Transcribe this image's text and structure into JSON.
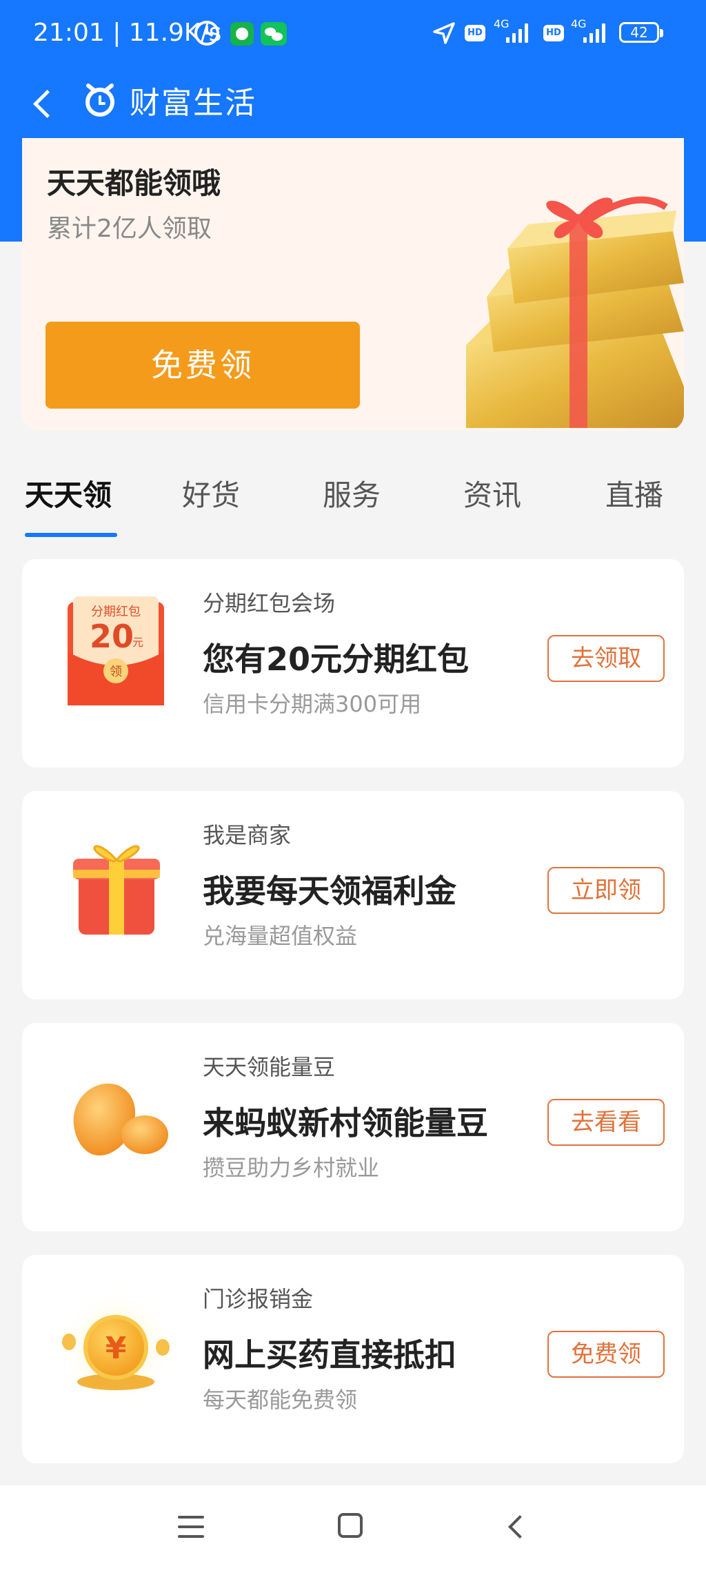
{
  "status_bar": {
    "time_speed": "21:01 | 11.9K/s",
    "network_1": "4G",
    "network_2": "4G",
    "hd_label": "HD",
    "battery": "42",
    "icons": [
      "alarm-icon",
      "app-notification-icon",
      "wechat-icon",
      "location-icon",
      "hd-icon",
      "signal-icon",
      "battery-icon"
    ]
  },
  "nav": {
    "title": "财富生活",
    "icons": [
      "back-icon",
      "wealth-logo-icon"
    ]
  },
  "hero": {
    "title": "天天都能领哦",
    "subtitle": "累计2亿人领取",
    "button_label": "免费领",
    "image": "gold-bars-gift-icon"
  },
  "tabs": [
    {
      "label": "天天领",
      "active": true
    },
    {
      "label": "好货",
      "active": false
    },
    {
      "label": "服务",
      "active": false
    },
    {
      "label": "资讯",
      "active": false
    },
    {
      "label": "直播",
      "active": false
    }
  ],
  "cards": [
    {
      "icon": "red-envelope-icon",
      "icon_text": {
        "top": "分期红包",
        "amount": "20",
        "unit": "元",
        "seal": "领"
      },
      "category": "分期红包会场",
      "title": "您有20元分期红包",
      "subtitle": "信用卡分期满300可用",
      "button": "去领取"
    },
    {
      "icon": "gift-box-icon",
      "category": "我是商家",
      "title": "我要每天领福利金",
      "subtitle": "兑海量超值权益",
      "button": "立即领"
    },
    {
      "icon": "energy-bean-icon",
      "category": "天天领能量豆",
      "title": "来蚂蚁新村领能量豆",
      "subtitle": "攒豆助力乡村就业",
      "button": "去看看"
    },
    {
      "icon": "yuan-coin-icon",
      "icon_text": {
        "symbol": "¥"
      },
      "category": "门诊报销金",
      "title": "网上买药直接抵扣",
      "subtitle": "每天都能免费领",
      "button": "免费领"
    }
  ],
  "system_nav": {
    "icons": [
      "menu-icon",
      "home-icon",
      "back-icon"
    ]
  },
  "colors": {
    "brand_blue": "#1677ff",
    "hero_bg": "#fff5ee",
    "hero_button": "#f59b1b",
    "card_button": "#e0723a"
  }
}
